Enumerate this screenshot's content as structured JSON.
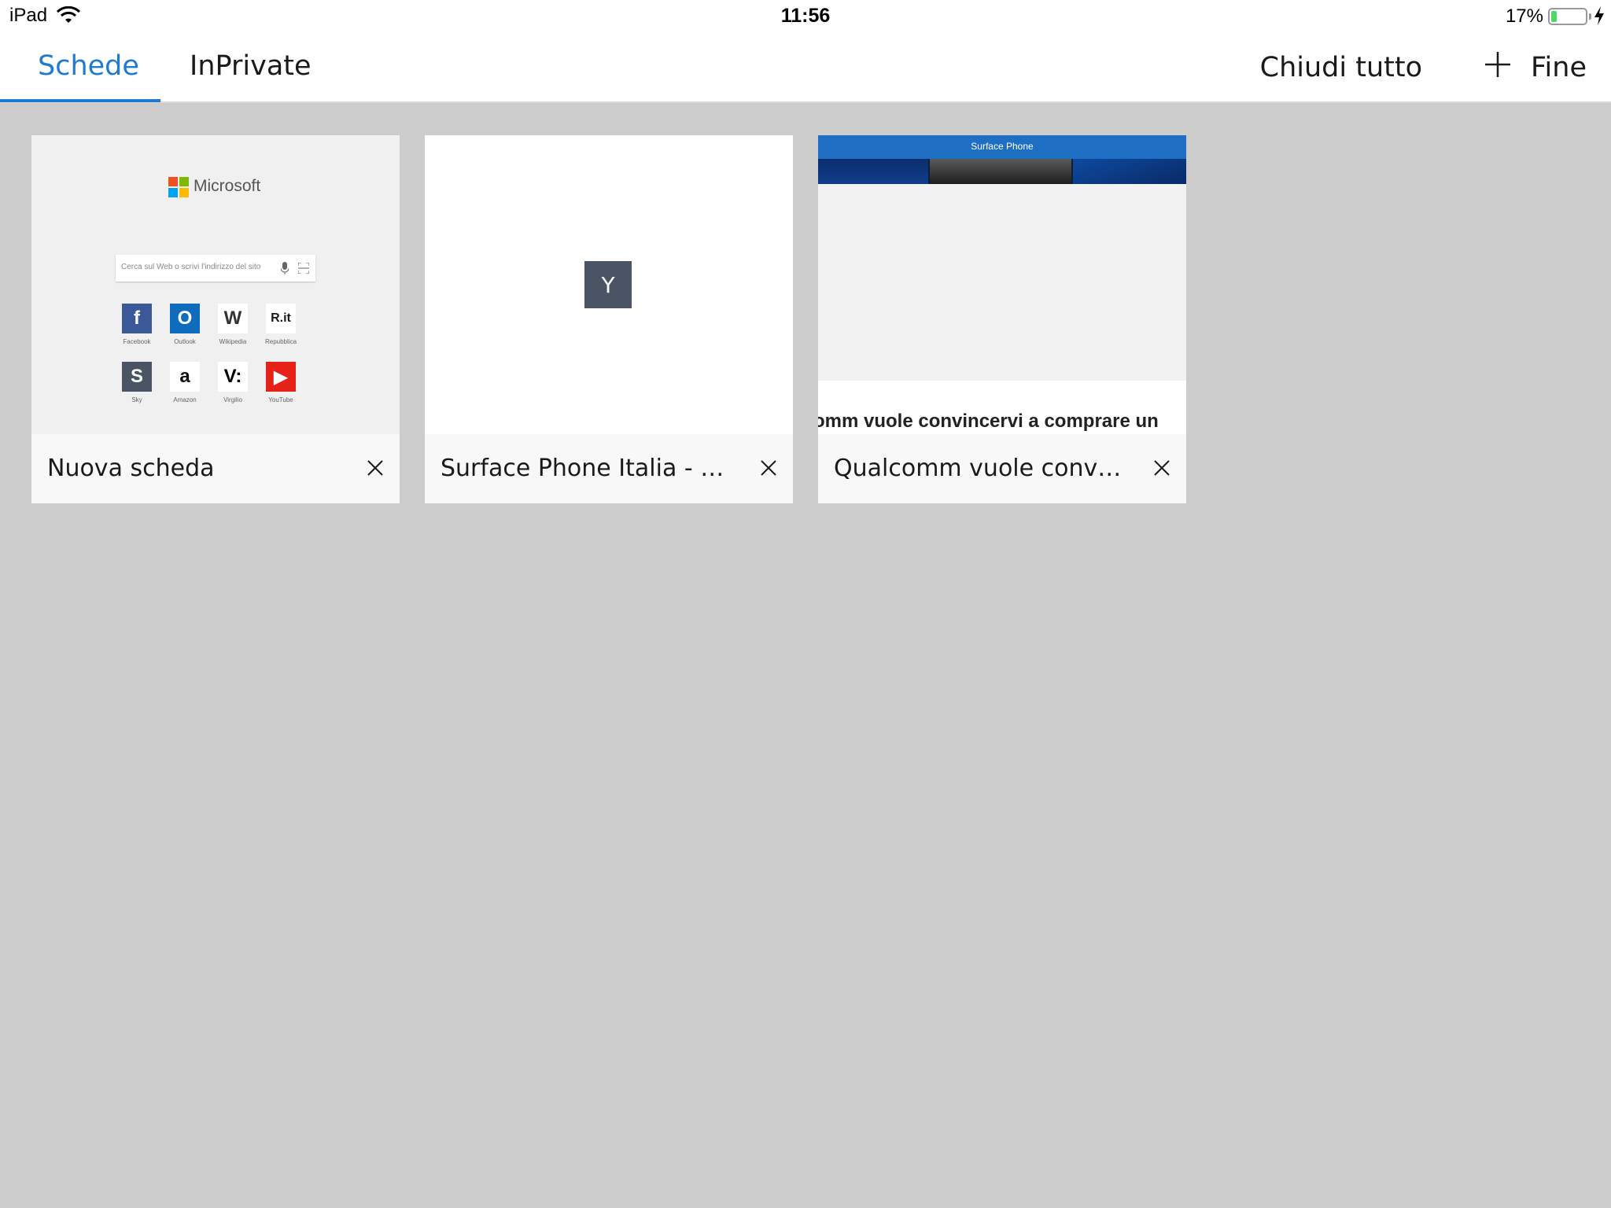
{
  "status_bar": {
    "device": "iPad",
    "time": "11:56",
    "battery_percent": "17%",
    "battery_level": 0.17,
    "charging": true
  },
  "header": {
    "tabs": [
      {
        "label": "Schede",
        "active": true
      },
      {
        "label": "InPrivate",
        "active": false
      }
    ],
    "close_all_label": "Chiudi tutto",
    "add_icon": "plus-icon",
    "done_label": "Fine",
    "accent_color": "#1f7ad1"
  },
  "tabs": [
    {
      "title": "Nuova scheda",
      "preview": {
        "brand": "Microsoft",
        "search_placeholder": "Cerca sul Web o scrivi l'indirizzo del sito",
        "tiles": [
          {
            "label": "Facebook",
            "glyph": "f",
            "color": "#3b5998"
          },
          {
            "label": "Outlook",
            "glyph": "O",
            "color": "#0f6cbd"
          },
          {
            "label": "Wikipedia",
            "glyph": "W",
            "color": "#ffffff"
          },
          {
            "label": "Repubblica",
            "glyph": "R.it",
            "color": "#ffffff"
          },
          {
            "label": "Sky",
            "glyph": "S",
            "color": "#4a5464"
          },
          {
            "label": "Amazon",
            "glyph": "a",
            "color": "#ffffff"
          },
          {
            "label": "Virgilio",
            "glyph": "V:",
            "color": "#ffffff"
          },
          {
            "label": "YouTube",
            "glyph": "▶",
            "color": "#e62117"
          }
        ]
      }
    },
    {
      "title": "Surface Phone Italia - You...",
      "preview": {
        "letter": "Y"
      }
    },
    {
      "title": "Qualcomm vuole convinc...",
      "preview": {
        "site_logo": "Surface Phone",
        "headline": "omm vuole convincervi a comprare un"
      }
    }
  ]
}
